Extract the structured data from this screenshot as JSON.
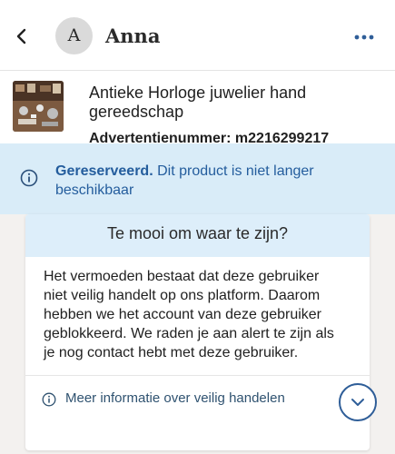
{
  "header": {
    "avatar_initial": "A",
    "name": "Anna",
    "back_icon": "chevron-left-icon",
    "more_icon": "more-horizontal-icon"
  },
  "listing": {
    "title": "Antieke Horloge juwelier hand gereedschap",
    "ad_number": "Advertentienummer: m2216299217",
    "thumbnail_icon": "listing-photo"
  },
  "banner": {
    "status": "Gereserveerd.",
    "message": "Dit product is niet langer beschikbaar",
    "icon": "info-icon",
    "text_color": "#245d9d",
    "background": "#d9ecf8"
  },
  "warning_card": {
    "title": "Te mooi om waar te zijn?",
    "body": "Het vermoeden bestaat dat deze gebruiker niet veilig handelt op ons platform. Daarom hebben we het account van deze gebruiker geblokkeerd. We raden je aan alert te zijn als je nog contact hebt met deze gebruiker.",
    "more_info_label": "Meer informatie over veilig handelen",
    "more_info_icon": "info-icon"
  },
  "scroll_button": {
    "icon": "chevron-down-icon",
    "accent": "#2f5e98"
  }
}
